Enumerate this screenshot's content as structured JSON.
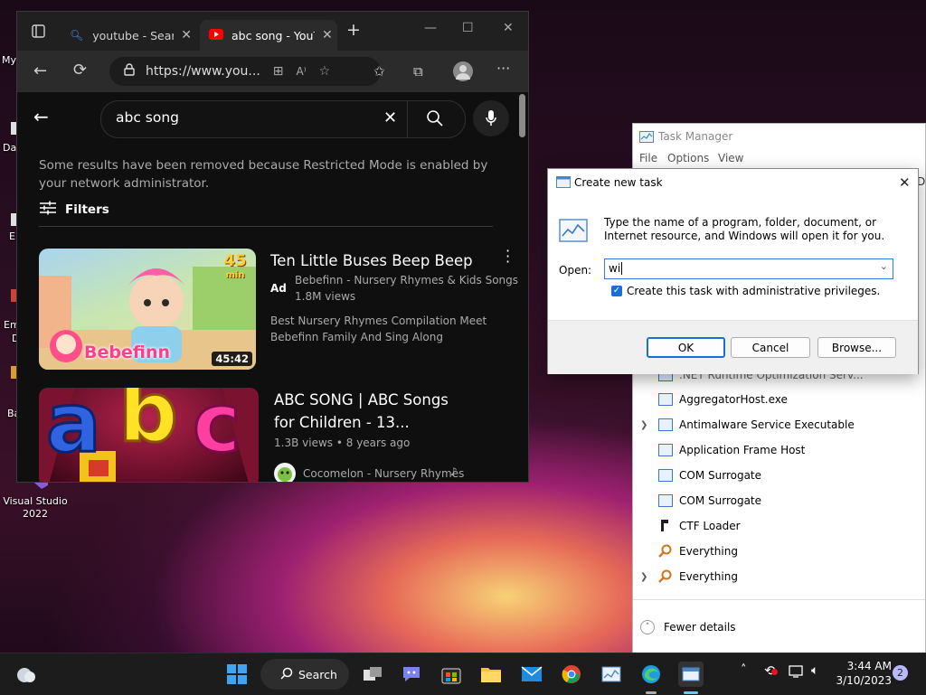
{
  "desktop": {
    "fragments": [
      "My",
      "Dat",
      "E",
      "Em",
      "D",
      "Ba"
    ],
    "visual_studio_label_line1": "Visual Studio",
    "visual_studio_label_line2": "2022"
  },
  "edge": {
    "tabs": [
      {
        "label": "youtube - Search",
        "icon": "search-icon"
      },
      {
        "label": "abc song - YouTube",
        "icon": "youtube-icon"
      }
    ],
    "new_tab_glyph": "+",
    "address": "https://www.you...",
    "toolbar_icons": [
      "back-icon",
      "refresh-icon",
      "lock-icon",
      "apps-icon",
      "read-aloud-icon",
      "add-favorite-icon",
      "favorites-icon",
      "collections-icon",
      "profile-icon",
      "more-icon"
    ]
  },
  "youtube": {
    "search_query": "abc song",
    "notice": "Some results have been removed because Restricted Mode is enabled by your network administrator.",
    "filters_label": "Filters",
    "videos": [
      {
        "title": "Ten Little Buses Beep Beep",
        "ad_badge": "Ad",
        "channel": "Bebefinn - Nursery Rhymes & Kids Songs",
        "views": "1.8M views",
        "description": "Best Nursery Rhymes Compilation Meet Bebefinn Family And Sing Along",
        "duration": "45:42",
        "thumb_badge_top": "45",
        "thumb_badge_bottom": "min",
        "thumb_brand": "Bebefinn"
      },
      {
        "title_line1": "ABC SONG | ABC Songs",
        "title_line2": "for Children - 13...",
        "views": "1.3B views",
        "age": "8 years ago",
        "channel": "Cocomelon - Nursery Rhymes",
        "thumb_letters": [
          "a",
          "b",
          "c"
        ]
      }
    ]
  },
  "task_manager": {
    "title": "Task Manager",
    "menu": [
      "File",
      "Options",
      "View"
    ],
    "partial_process": ".NET Runtime Optimization Serv...",
    "processes": [
      {
        "name": "AggregatorHost.exe",
        "expandable": false,
        "icon": "window-icon"
      },
      {
        "name": "Antimalware Service Executable",
        "expandable": true,
        "icon": "window-icon"
      },
      {
        "name": "Application Frame Host",
        "expandable": false,
        "icon": "window-icon"
      },
      {
        "name": "COM Surrogate",
        "expandable": false,
        "icon": "window-icon"
      },
      {
        "name": "COM Surrogate",
        "expandable": false,
        "icon": "window-icon"
      },
      {
        "name": "CTF Loader",
        "expandable": false,
        "icon": "ctf-icon"
      },
      {
        "name": "Everything",
        "expandable": false,
        "icon": "magnifier-icon"
      },
      {
        "name": "Everything",
        "expandable": true,
        "icon": "magnifier-icon"
      }
    ],
    "right_fragment": "De",
    "fewer_details": "Fewer details"
  },
  "dialog": {
    "title": "Create new task",
    "description": "Type the name of a program, folder, document, or Internet resource, and Windows will open it for you.",
    "open_label": "Open:",
    "open_value": "wi",
    "admin_checkbox_label": "Create this task with administrative privileges.",
    "admin_checked": true,
    "ok": "OK",
    "cancel": "Cancel",
    "browse": "Browse..."
  },
  "taskbar": {
    "search_label": "Search",
    "time": "3:44 AM",
    "date": "3/10/2023",
    "notification_count": "2"
  }
}
